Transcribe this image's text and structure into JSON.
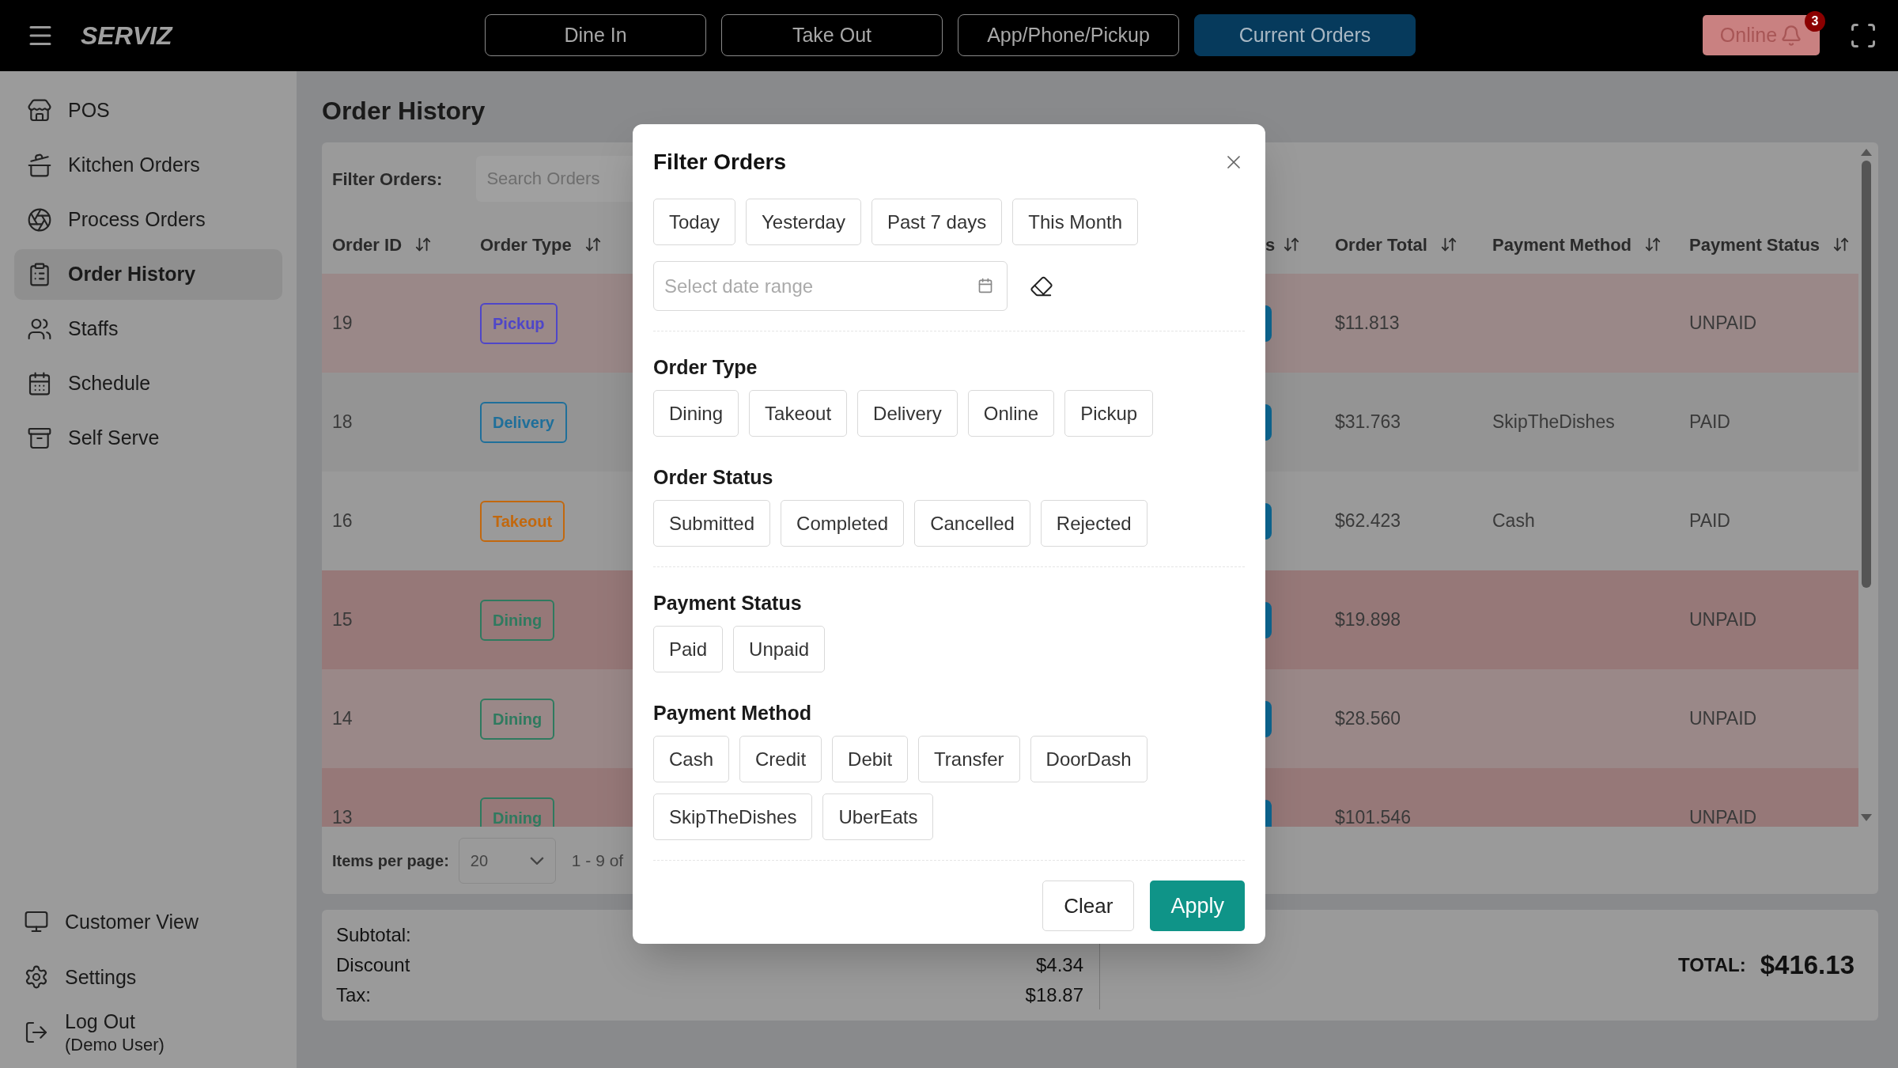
{
  "topbar": {
    "brand": "SERVIZ",
    "nav": [
      {
        "label": "Dine In",
        "selected": false
      },
      {
        "label": "Take Out",
        "selected": false
      },
      {
        "label": "App/Phone/Pickup",
        "selected": false
      },
      {
        "label": "Current Orders",
        "selected": true
      }
    ],
    "online": {
      "label": "Online",
      "badge": "3"
    }
  },
  "sidebar": {
    "items": [
      {
        "label": "POS",
        "selected": false
      },
      {
        "label": "Kitchen Orders",
        "selected": false
      },
      {
        "label": "Process Orders",
        "selected": false
      },
      {
        "label": "Order History",
        "selected": true
      },
      {
        "label": "Staffs",
        "selected": false
      },
      {
        "label": "Schedule",
        "selected": false
      },
      {
        "label": "Self Serve",
        "selected": false
      }
    ],
    "footer": [
      {
        "label": "Customer View"
      },
      {
        "label": "Settings"
      },
      {
        "label": "Log Out",
        "sub": "(Demo User)"
      }
    ]
  },
  "page": {
    "title": "Order History"
  },
  "table": {
    "filter_label": "Filter Orders:",
    "search": {
      "placeholder": "Search Orders"
    },
    "columns": [
      "Order ID",
      "Order Type",
      "s",
      "Order Total",
      "Payment Method",
      "Payment Status"
    ],
    "rows": [
      {
        "id": "19",
        "type": {
          "label": "Pickup",
          "color": "#4f46c8"
        },
        "total": "$11.813",
        "status": "UNPAID",
        "flagged": true
      },
      {
        "id": "18",
        "type": {
          "label": "Delivery",
          "color": "#1f6f9a"
        },
        "total": "$31.763",
        "method": "SkipTheDishes",
        "status": "PAID",
        "flagged": false
      },
      {
        "id": "16",
        "type": {
          "label": "Takeout",
          "color": "#c2680e"
        },
        "total": "$62.423",
        "method": "Cash",
        "status": "PAID",
        "flagged": false
      },
      {
        "id": "15",
        "type": {
          "label": "Dining",
          "color": "#2f7a5f"
        },
        "total": "$19.898",
        "status": "UNPAID",
        "flagged": true
      },
      {
        "id": "14",
        "type": {
          "label": "Dining",
          "color": "#2f7a5f"
        },
        "total": "$28.560",
        "status": "UNPAID",
        "flagged": true
      },
      {
        "id": "13",
        "type": {
          "label": "Dining",
          "color": "#2f7a5f"
        },
        "total": "$101.546",
        "status": "UNPAID",
        "flagged": true
      }
    ]
  },
  "pagination": {
    "label": "Items per page:",
    "per_page": "20",
    "range": "1 - 9 of"
  },
  "summary": {
    "lines": [
      {
        "label": "Subtotal:"
      },
      {
        "label": "Discount",
        "value": "$4.34"
      },
      {
        "label": "Tax:",
        "value": "$18.87"
      }
    ],
    "total_label": "TOTAL:",
    "total": "$416.13"
  },
  "filter_modal": {
    "title": "Filter Orders",
    "quick_ranges": [
      {
        "label": "Today",
        "selected": false
      },
      {
        "label": "Yesterday",
        "selected": false
      },
      {
        "label": "Past 7 days",
        "selected": false
      },
      {
        "label": "This Month",
        "selected": false
      }
    ],
    "date_range": {
      "placeholder": "Select date range"
    },
    "groups": [
      {
        "sections": [
          {
            "title": "Order Type",
            "options": [
              "Dining",
              "Takeout",
              "Delivery",
              "Online",
              "Pickup"
            ]
          },
          {
            "title": "Order Status",
            "options": [
              "Submitted",
              "Completed",
              "Cancelled",
              "Rejected"
            ]
          }
        ]
      },
      {
        "sections": [
          {
            "title": "Payment Status",
            "options": [
              "Paid",
              "Unpaid"
            ]
          },
          {
            "title": "Payment Method",
            "options": [
              "Cash",
              "Credit",
              "Debit",
              "Transfer",
              "DoorDash",
              "SkipTheDishes",
              "UberEats"
            ]
          }
        ]
      }
    ],
    "clear": "Clear",
    "apply": "Apply"
  }
}
